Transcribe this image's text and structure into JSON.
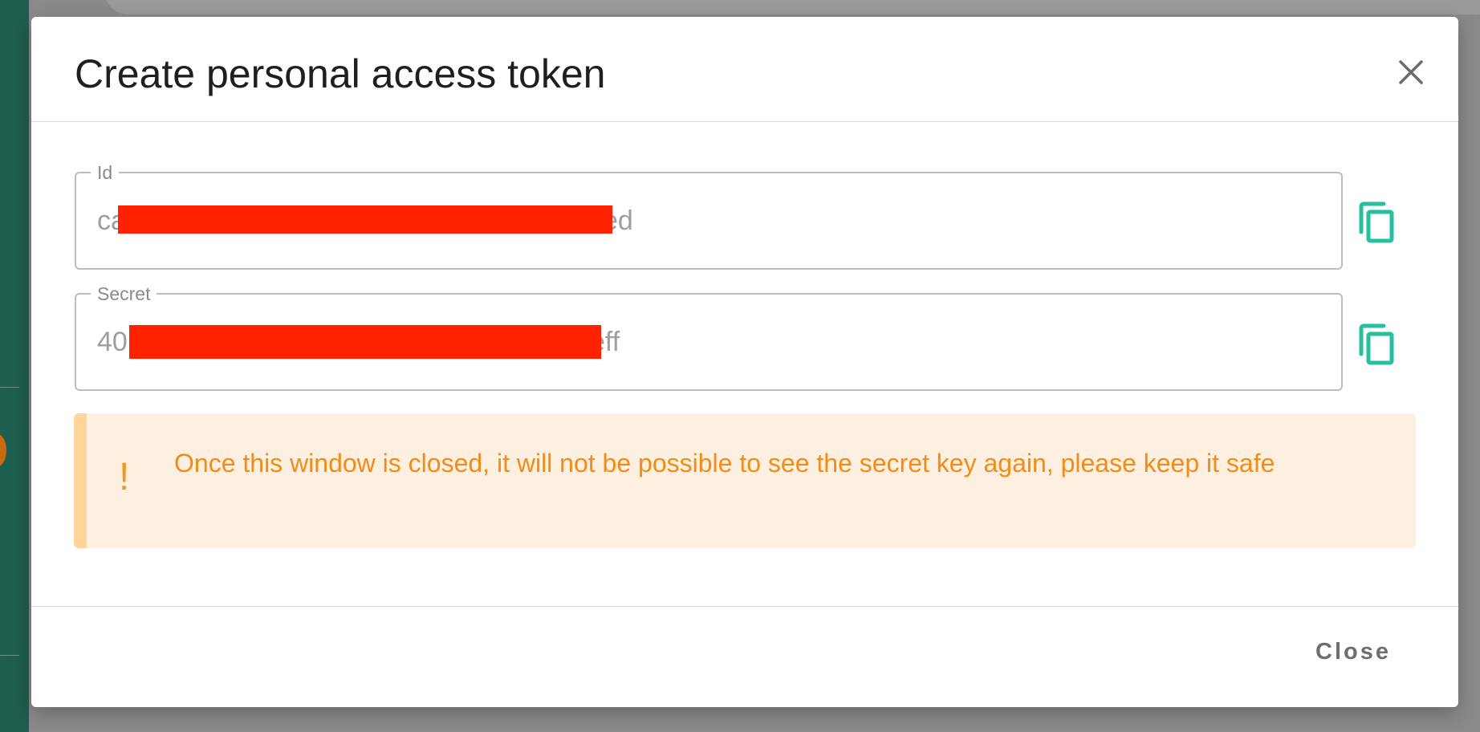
{
  "dialog": {
    "title": "Create personal access token",
    "close_icon": "close-icon",
    "fields": [
      {
        "label": "Id",
        "value_start": "ca",
        "value_end": "ed",
        "copy_icon": "copy-icon"
      },
      {
        "label": "Secret",
        "value_start": "40",
        "value_end": "eff",
        "copy_icon": "copy-icon"
      }
    ],
    "alert": {
      "icon": "!",
      "text": "Once this window is closed, it will not be possible to see the secret key again, please keep it safe"
    },
    "footer": {
      "close_label": "Close"
    }
  },
  "colors": {
    "accent": "#26bfa0",
    "redaction": "#ff2200",
    "warning_text": "#f28c16",
    "warning_bg": "#fdf0e1"
  }
}
